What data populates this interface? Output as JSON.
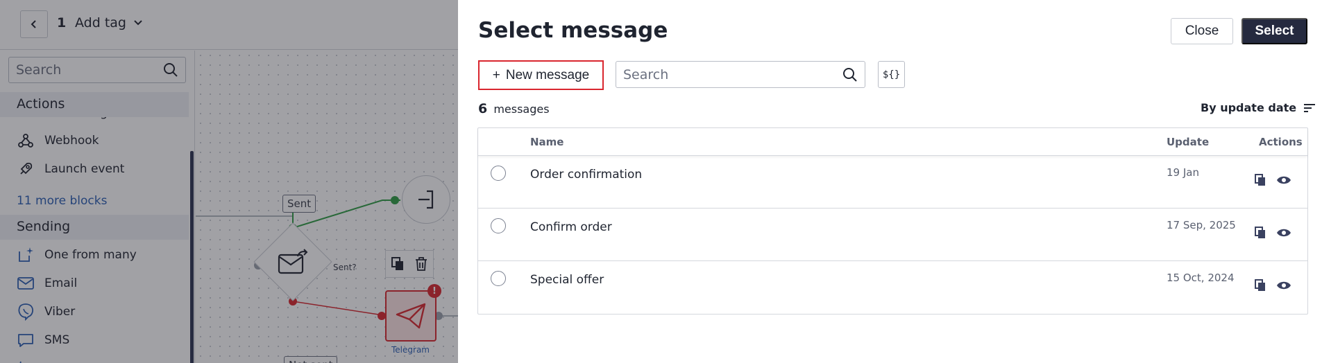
{
  "topbar": {
    "step_number": "1",
    "add_tag_label": "Add tag"
  },
  "palette": {
    "search_placeholder": "Search",
    "cut_item": "Add to segment",
    "actions_heading": "Actions",
    "actions_items": [
      "Webhook",
      "Launch event"
    ],
    "more_blocks": "11 more blocks",
    "sending_heading": "Sending",
    "sending_items": [
      "One from many",
      "Email",
      "Viber",
      "SMS"
    ]
  },
  "canvas": {
    "sent_label": "Sent",
    "sent_question": "Sent?",
    "not_sent_label": "Not sent",
    "telegram_label": "Telegram",
    "error_badge": "!"
  },
  "modal": {
    "title": "Select message",
    "close_label": "Close",
    "select_label": "Select",
    "new_message_label": "New message",
    "new_message_plus": "+",
    "search_placeholder": "Search",
    "variables_label": "${}",
    "count_value": "6",
    "count_unit": "messages",
    "sort_label": "By update date",
    "columns": {
      "name": "Name",
      "update": "Update",
      "actions": "Actions"
    },
    "rows": [
      {
        "name": "Order confirmation",
        "date": "19 Jan"
      },
      {
        "name": "Confirm order",
        "date": "17 Sep, 2025"
      },
      {
        "name": "Special offer",
        "date": "15 Oct, 2024"
      }
    ]
  },
  "colors": {
    "accent_dark": "#252a3f",
    "highlight_border": "#d9262e",
    "link": "#2b5fb4",
    "error": "#d9262e"
  }
}
